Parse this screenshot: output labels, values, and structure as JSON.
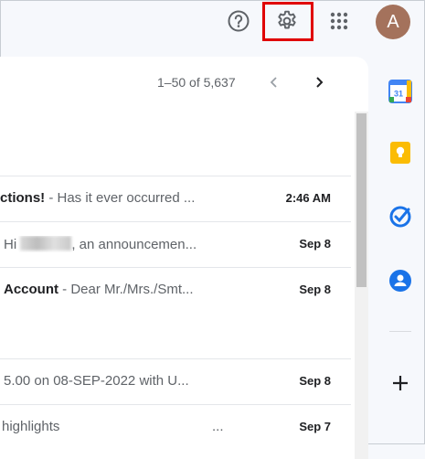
{
  "header": {
    "avatar_letter": "A",
    "help_icon": "help-circle-icon",
    "settings_icon": "gear-icon",
    "apps_icon": "apps-grid-icon"
  },
  "toolbar": {
    "pagination": "1–50 of 5,637"
  },
  "emails": [
    {
      "subject": "ctions!",
      "snippet": " - Has it ever occurred ...",
      "date": "2:46 AM"
    },
    {
      "subject": "",
      "snippet": "Hi ",
      "snippet_after": ", an announcemen...",
      "date": "Sep 8"
    },
    {
      "subject": "Account",
      "snippet": " - Dear Mr./Mrs./Smt...",
      "date": "Sep 8"
    },
    {
      "subject": "",
      "snippet": "5.00 on 08-SEP-2022 with U...",
      "date": "Sep 8"
    },
    {
      "subject": "",
      "snippet": "highlights",
      "ellipsis": "...",
      "date": "Sep 7"
    }
  ],
  "side_panel": {
    "calendar_day": "31",
    "items": [
      "calendar-icon",
      "keep-icon",
      "tasks-icon",
      "contacts-icon",
      "add-icon"
    ]
  },
  "colors": {
    "highlight": "#e00000",
    "avatar": "#a4725c",
    "tasks_blue": "#1a73e8",
    "keep_yellow": "#fbbc04"
  }
}
